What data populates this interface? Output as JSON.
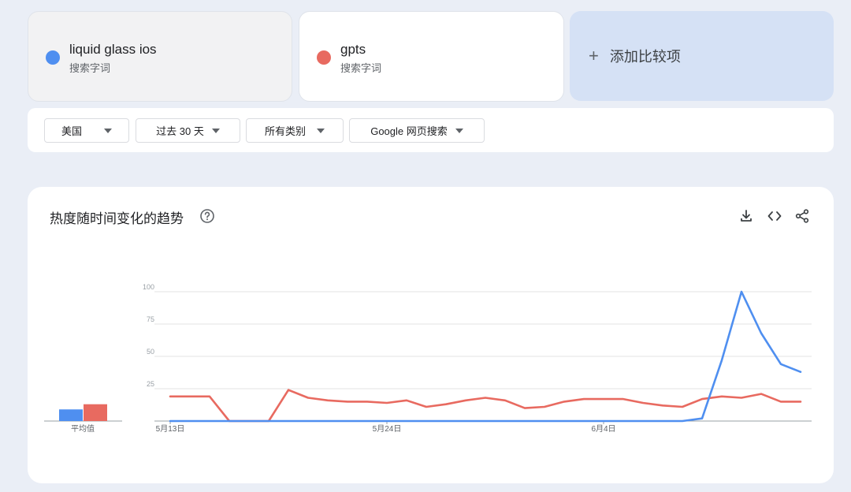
{
  "terms": [
    {
      "name": "liquid glass ios",
      "type": "搜索字词",
      "color": "#4f8ff0"
    },
    {
      "name": "gpts",
      "type": "搜索字词",
      "color": "#e86a60"
    }
  ],
  "add_compare": {
    "icon": "plus-icon",
    "label": "添加比较项"
  },
  "filters": {
    "region": "美国",
    "period": "过去 30 天",
    "category": "所有类别",
    "search_type": "Google 网页搜索"
  },
  "chart_panel": {
    "title": "热度随时间变化的趋势",
    "help_icon": "help-circle-icon",
    "actions": [
      "download-icon",
      "embed-code-icon",
      "share-icon"
    ]
  },
  "chart_data": [
    {
      "type": "bar",
      "xlabel": "平均值",
      "ylim": [
        0,
        100
      ],
      "categories": [
        "liquid glass ios",
        "gpts"
      ],
      "values": [
        9,
        13
      ],
      "colors": [
        "#4f8ff0",
        "#e86a60"
      ]
    },
    {
      "type": "line",
      "ylim": [
        0,
        100
      ],
      "yticks": [
        25,
        50,
        75,
        100
      ],
      "grid": true,
      "x_start": "5月13日",
      "x_end": "6月13日",
      "xtick_labels": [
        {
          "label": "5月13日",
          "index": 0
        },
        {
          "label": "5月24日",
          "index": 11
        },
        {
          "label": "6月4日",
          "index": 22
        }
      ],
      "series": [
        {
          "name": "liquid glass ios",
          "color": "#4f8ff0",
          "values": [
            0,
            0,
            0,
            0,
            0,
            0,
            0,
            0,
            0,
            0,
            0,
            0,
            0,
            0,
            0,
            0,
            0,
            0,
            0,
            0,
            0,
            0,
            0,
            0,
            0,
            0,
            0,
            2,
            47,
            100,
            68,
            44,
            38
          ]
        },
        {
          "name": "gpts",
          "color": "#e86a60",
          "values": [
            19,
            19,
            19,
            0,
            0,
            0,
            24,
            18,
            16,
            15,
            15,
            14,
            16,
            11,
            13,
            16,
            18,
            16,
            10,
            11,
            15,
            17,
            17,
            17,
            14,
            12,
            11,
            17,
            19,
            18,
            21,
            15,
            15
          ]
        }
      ]
    }
  ]
}
